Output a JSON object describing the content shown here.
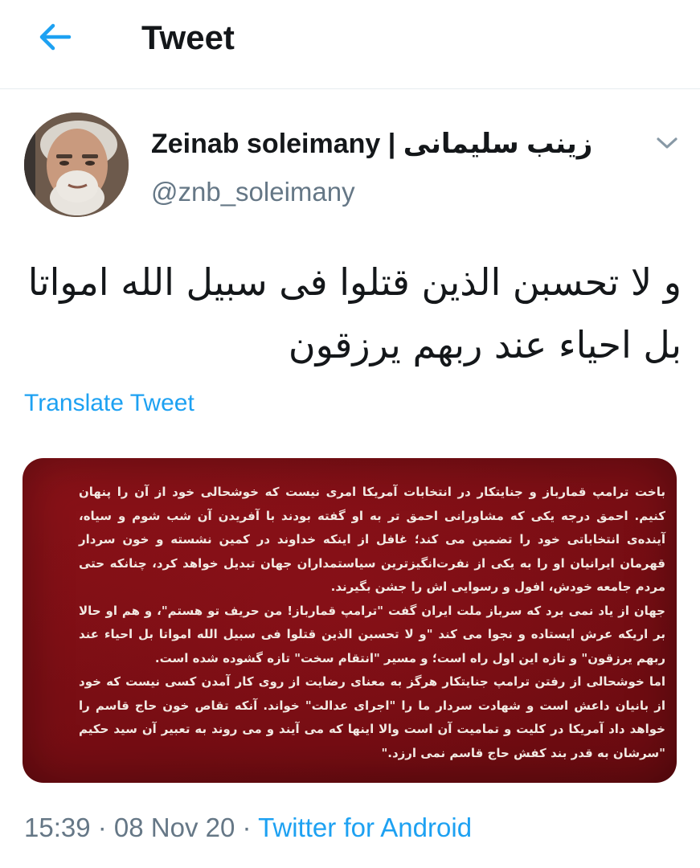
{
  "header": {
    "title": "Tweet",
    "back_icon": "arrow-left-icon",
    "accent": "#1da1f2"
  },
  "author": {
    "name": "Zeinab soleimany | زینب سلیمانی",
    "handle": "@znb_soleimany"
  },
  "tweet": {
    "text_line_1": "و لا تحسبن الذین قتلوا فی سبیل الله امواتا",
    "text_line_2": "بل احیاء عند ربهم یرزقون",
    "translate_label": "Translate Tweet"
  },
  "media": {
    "background": "#7a0e14",
    "paragraphs": [
      "باخت ترامپ قمارباز و جنایتکار در انتخابات آمریکا امری نیست که خوشحالی خود از آن را پنهان کنیم. احمق درجه یکی که مشاورانی احمق تر به او گفته بودند با آفریدن آن شب شوم و سیاه، آینده‌ی انتخاباتی خود را تضمین می کند؛ غافل از اینکه خداوند در کمین نشسته و خون سردار قهرمان ایرانیان او را به یکی از نفرت‌انگیزترین سیاستمداران جهان تبدیل خواهد کرد، چنانکه حتی مردم جامعه خودش، افول و رسوایی اش را جشن بگیرند.",
      "جهان از یاد نمی برد که سرباز ملت ایران گفت \"ترامپ قمارباز! من حریف تو هستم\"، و هم او حالا بر اریکه عرش ایستاده و نجوا می کند \"و لا تحسبن الذین قتلوا فی سبیل الله امواتا بل احیاء عند ربهم یرزقون\" و تازه این اول راه است؛ و مسیر \"انتقام سخت\" تازه گشوده شده است.",
      "اما خوشحالی از رفتن ترامپ جنایتکار هرگز به معنای رضایت از روی کار آمدن کسی نیست که خود از بانیان داعش است و شهادت سردار ما را \"اجرای عدالت\" خواند. آنکه تقاص خون حاج قاسم را خواهد داد آمریکا در کلیت و تمامیت آن است والا اینها که می آیند و می روند به تعبیر آن سید حکیم \"سرشان به قدر بند کفش حاج قاسم نمی ارزد.\""
    ]
  },
  "meta": {
    "time": "15:39",
    "separator_1": " · ",
    "date": "08 Nov 20",
    "separator_2": " · ",
    "source": "Twitter for Android"
  }
}
